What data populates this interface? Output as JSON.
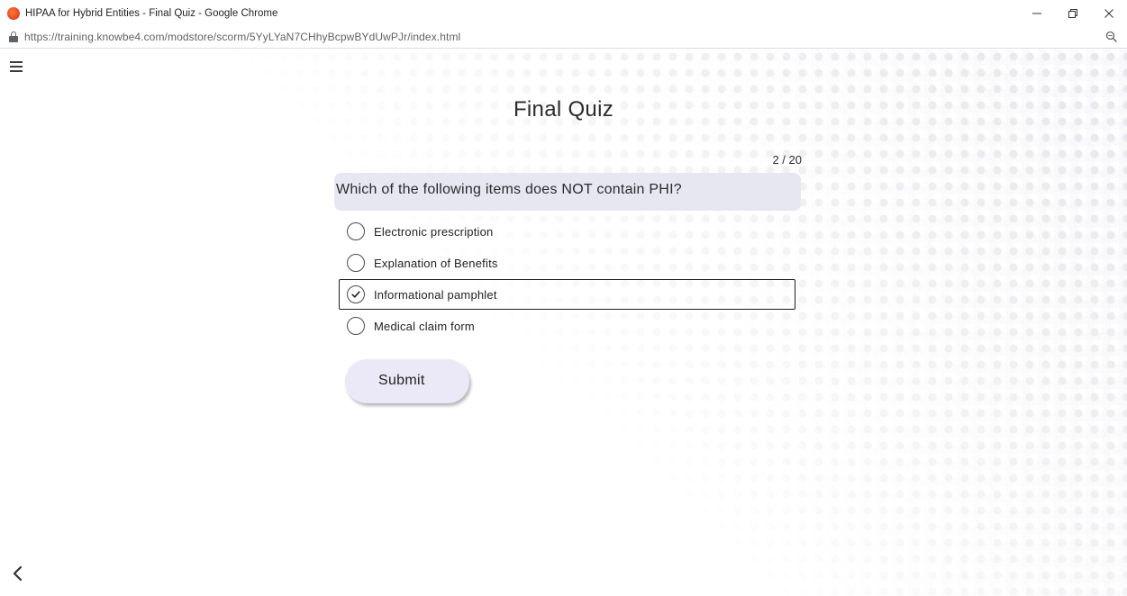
{
  "window": {
    "title": "HIPAA for Hybrid Entities - Final Quiz - Google Chrome",
    "controls": {
      "minimize": "—",
      "restore": "❐",
      "close": "✕"
    }
  },
  "address_bar": {
    "url": "https://training.knowbe4.com/modstore/scorm/5YyLYaN7CHhyBcpwBYdUwPJr/index.html"
  },
  "icons": {
    "app": "chrome-app-icon",
    "lock": "lock-icon",
    "zoom": "zoom-icon",
    "menu": "hamburger-menu-icon",
    "back": "chevron-left-icon",
    "check": "checkmark-icon"
  },
  "quiz": {
    "title": "Final Quiz",
    "progress": "2 / 20",
    "question": "Which of the following items does NOT contain PHI?",
    "answers": [
      {
        "label": "Electronic prescription",
        "selected": false
      },
      {
        "label": "Explanation of Benefits",
        "selected": false
      },
      {
        "label": "Informational pamphlet",
        "selected": true
      },
      {
        "label": "Medical claim form",
        "selected": false
      }
    ],
    "submit_label": "Submit"
  },
  "colors": {
    "question_bg": "#e6e7f1",
    "submit_bg": "#ebe9f7",
    "text": "#2b2b2b"
  }
}
